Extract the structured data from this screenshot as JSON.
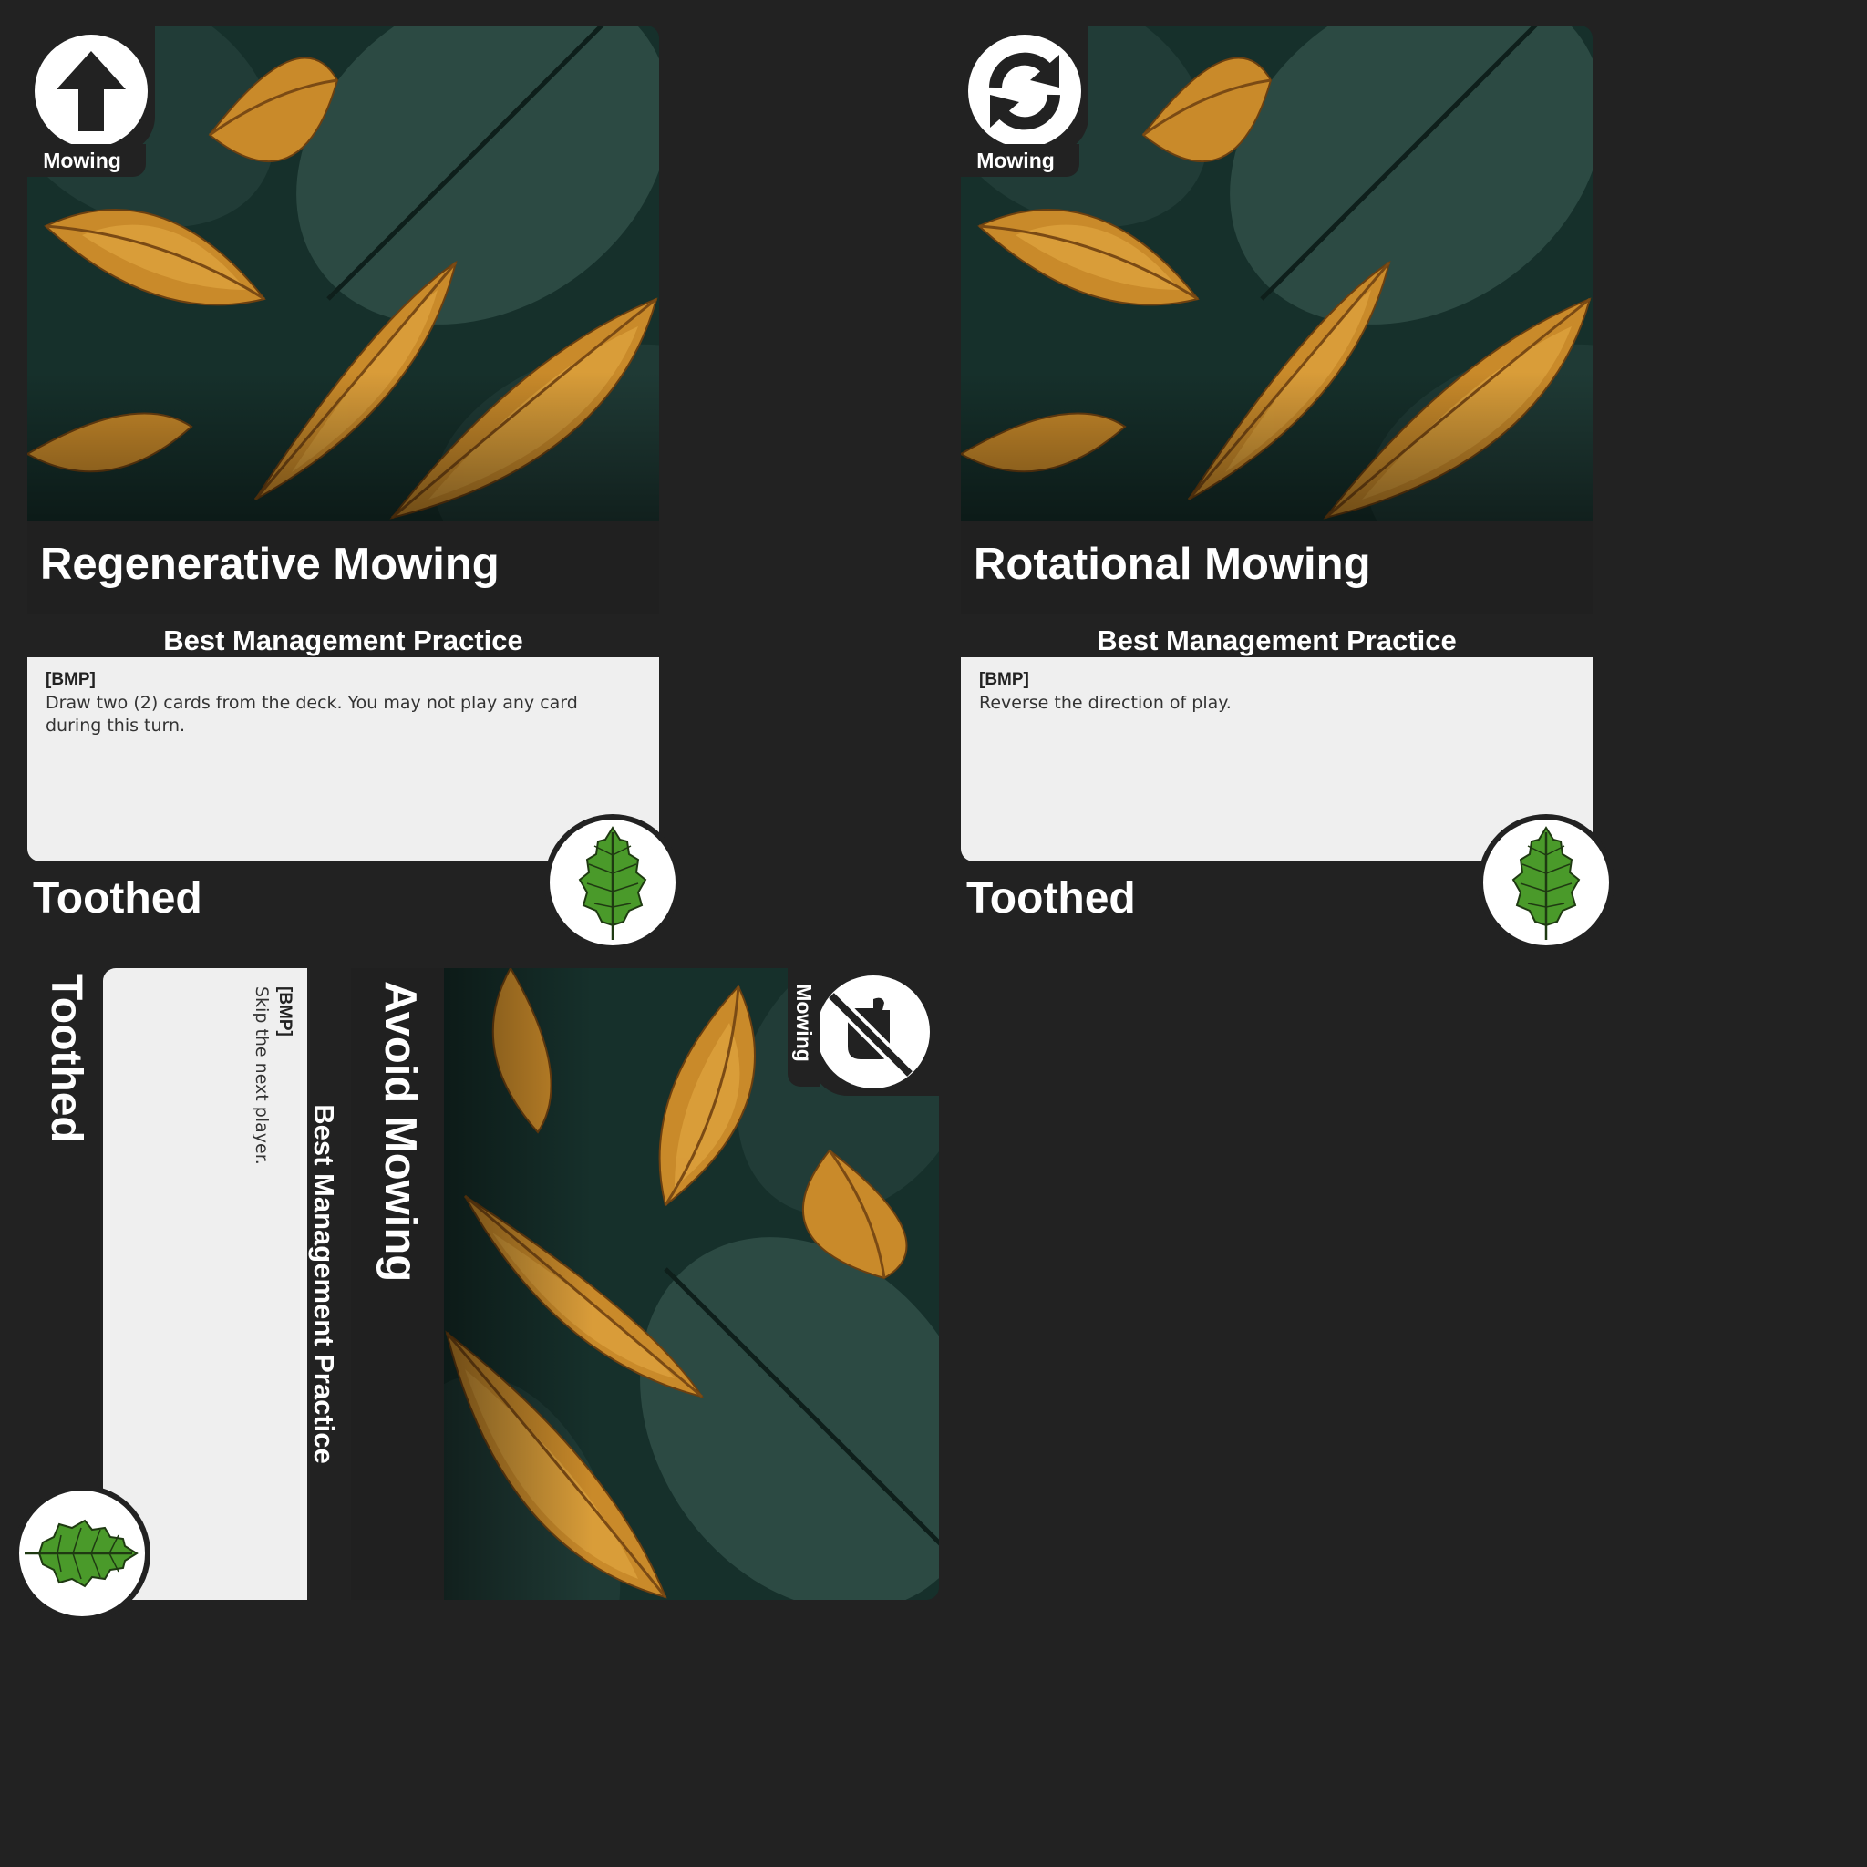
{
  "cards": [
    {
      "type_label": "Mowing",
      "type_icon": "arrow-up-icon",
      "title": "Regenerative Mowing",
      "subtitle": "Best Management Practice",
      "tag": "[BMP]",
      "rule": "Draw two (2) cards from the deck. You may not play any card during this turn.",
      "category": "Toothed",
      "leaf_icon": "toothed-leaf-icon"
    },
    {
      "type_label": "Mowing",
      "type_icon": "reverse-arrows-icon",
      "title": "Rotational Mowing",
      "subtitle": "Best Management Practice",
      "tag": "[BMP]",
      "rule": "Reverse the direction of play.",
      "category": "Toothed",
      "leaf_icon": "toothed-leaf-icon"
    },
    {
      "type_label": "Mowing",
      "type_icon": "skip-hand-icon",
      "title": "Avoid Mowing",
      "subtitle": "Best Management Practice",
      "tag": "[BMP]",
      "rule": "Skip the next player.",
      "category": "Toothed",
      "leaf_icon": "toothed-leaf-icon",
      "orientation": "rotated"
    }
  ],
  "colors": {
    "background": "#222222",
    "text_box": "#efefef",
    "leaf_green": "#4a9a2a",
    "leaf_gold": "#c98a2a",
    "leaf_teal": "#2c4a43"
  }
}
